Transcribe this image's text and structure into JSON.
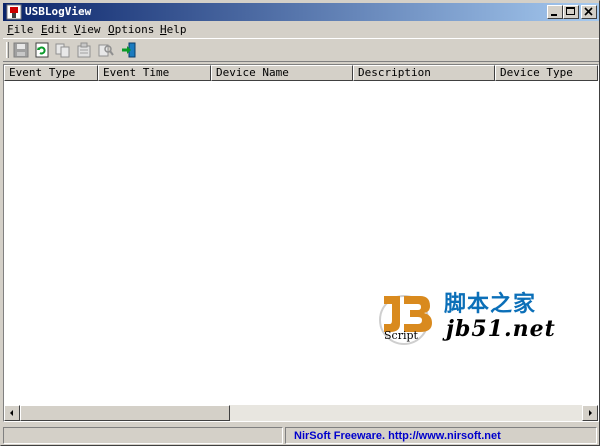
{
  "window": {
    "title": "USBLogView",
    "controls": [
      "minimize-icon",
      "maximize-icon",
      "close-icon"
    ]
  },
  "menu": {
    "items": [
      {
        "accel": "F",
        "rest": "ile"
      },
      {
        "accel": "E",
        "rest": "dit"
      },
      {
        "accel": "V",
        "rest": "iew"
      },
      {
        "accel": "O",
        "rest": "ptions"
      },
      {
        "accel": "H",
        "rest": "elp"
      }
    ]
  },
  "toolbar": {
    "buttons": [
      {
        "icon": "save-icon",
        "enabled": false
      },
      {
        "icon": "refresh-icon",
        "enabled": true
      },
      {
        "icon": "copy-icon",
        "enabled": false
      },
      {
        "icon": "properties-icon",
        "enabled": false
      },
      {
        "icon": "find-icon",
        "enabled": false
      },
      {
        "icon": "exit-icon",
        "enabled": true
      }
    ]
  },
  "list": {
    "columns": [
      "Event Type",
      "Event Time",
      "Device Name",
      "Description",
      "Device Type"
    ],
    "rows": []
  },
  "watermark": {
    "cn_text": "脚本之家",
    "script_text": "Script",
    "url_text": "jb51.net"
  },
  "statusbar": {
    "link_text": "NirSoft Freeware.  http://www.nirsoft.net"
  },
  "colors": {
    "face": "#d4d0c8",
    "title_start": "#0a246a",
    "title_end": "#a6caf0",
    "link": "#0000cc",
    "watermark_cn": "#0b6fb8"
  }
}
